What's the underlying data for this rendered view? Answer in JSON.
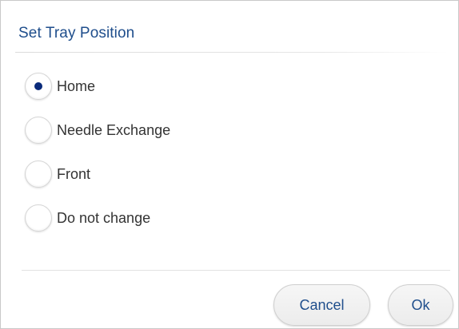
{
  "dialog": {
    "title": "Set Tray Position",
    "options": [
      {
        "label": "Home",
        "selected": true
      },
      {
        "label": "Needle Exchange",
        "selected": false
      },
      {
        "label": "Front",
        "selected": false
      },
      {
        "label": "Do not change",
        "selected": false
      }
    ],
    "buttons": {
      "cancel_label": "Cancel",
      "ok_label": "Ok"
    }
  },
  "colors": {
    "title": "#1f4e8c",
    "selected_dot": "#0a2a7a",
    "button_text": "#1f4e8c"
  }
}
